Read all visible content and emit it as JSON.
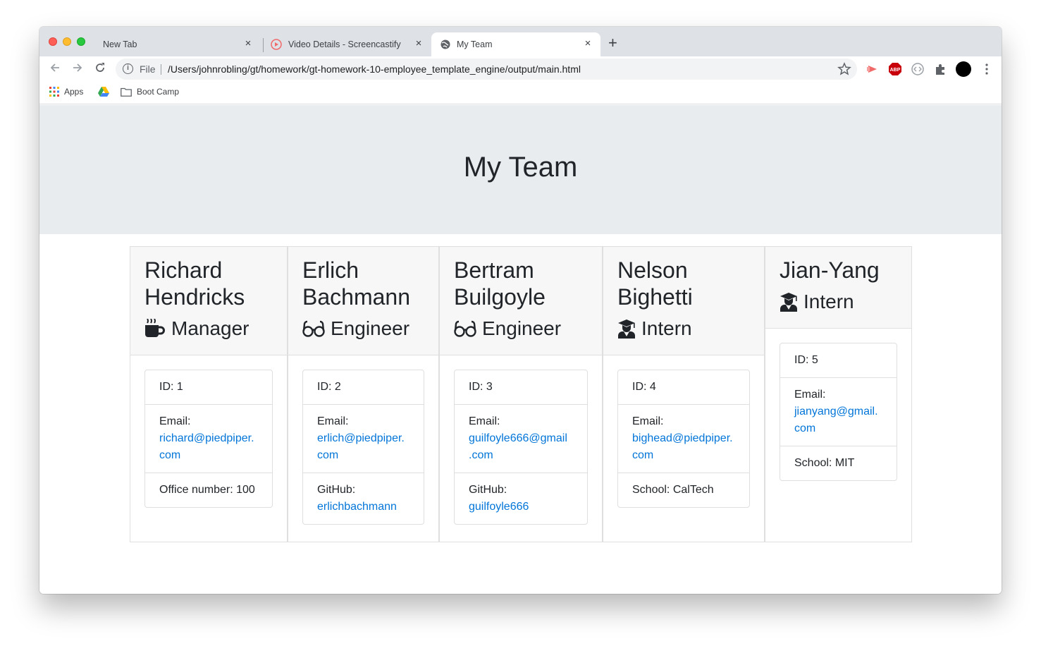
{
  "browser": {
    "tabs": [
      {
        "label": "New Tab",
        "active": false
      },
      {
        "label": "Video Details - Screencastify",
        "active": false
      },
      {
        "label": "My Team",
        "active": true
      }
    ],
    "new_tab_label": "+",
    "close_label": "×",
    "omnibox": {
      "scheme_label": "File",
      "url": "/Users/johnrobling/gt/homework/gt-homework-10-employee_template_engine/output/main.html"
    },
    "bookmarks": [
      {
        "label": "Apps",
        "icon": "apps-grid-icon"
      },
      {
        "label": "",
        "icon": "google-drive-icon"
      },
      {
        "label": "Boot Camp",
        "icon": "folder-icon"
      }
    ],
    "extensions": [
      "screencastify-icon",
      "adblock-plus-icon",
      "code-extension-icon",
      "extensions-puzzle-icon",
      "profile-avatar-icon",
      "more-menu-icon"
    ]
  },
  "page": {
    "title": "My Team",
    "jumbotron_color": "#e9ecef",
    "link_color": "#0275d8",
    "employees": [
      {
        "name_line1": "Richard",
        "name_line2": "Hendricks",
        "role": "Manager",
        "role_icon": "coffee-mug-icon",
        "id_label": "ID: 1",
        "email_label": "Email:",
        "email": "richard@piedpiper.com",
        "email_line1": "richard@piedpiper.",
        "email_line2": "com",
        "extra_label": "Office number: 100",
        "extra_link": ""
      },
      {
        "name_line1": "Erlich",
        "name_line2": "Bachmann",
        "role": "Engineer",
        "role_icon": "glasses-icon",
        "id_label": "ID: 2",
        "email_label": "Email:",
        "email": "erlich@piedpiper.com",
        "email_line1": "erlich@piedpiper.",
        "email_line2": "com",
        "extra_label": "GitHub:",
        "extra_link": "erlichbachmann"
      },
      {
        "name_line1": "Bertram",
        "name_line2": "Builgoyle",
        "role": "Engineer",
        "role_icon": "glasses-icon",
        "id_label": "ID: 3",
        "email_label": "Email:",
        "email": "guilfoyle666@gmail.com",
        "email_line1": "guilfoyle666@gmail",
        "email_line2": ".com",
        "extra_label": "GitHub:",
        "extra_link": "guilfoyle666"
      },
      {
        "name_line1": "Nelson",
        "name_line2": "Bighetti",
        "role": "Intern",
        "role_icon": "graduate-icon",
        "id_label": "ID: 4",
        "email_label": "Email:",
        "email": "bighead@piedpiper.com",
        "email_line1": "bighead@piedpiper.",
        "email_line2": "com",
        "extra_label": "School: CalTech",
        "extra_link": ""
      },
      {
        "name_line1": "Jian-Yang",
        "name_line2": "",
        "role": "Intern",
        "role_icon": "graduate-icon",
        "id_label": "ID: 5",
        "email_label": "Email:",
        "email": "jianyang@gmail.com",
        "email_line1": "jianyang@gmail.",
        "email_line2": "com",
        "extra_label": "School: MIT",
        "extra_link": ""
      }
    ]
  }
}
